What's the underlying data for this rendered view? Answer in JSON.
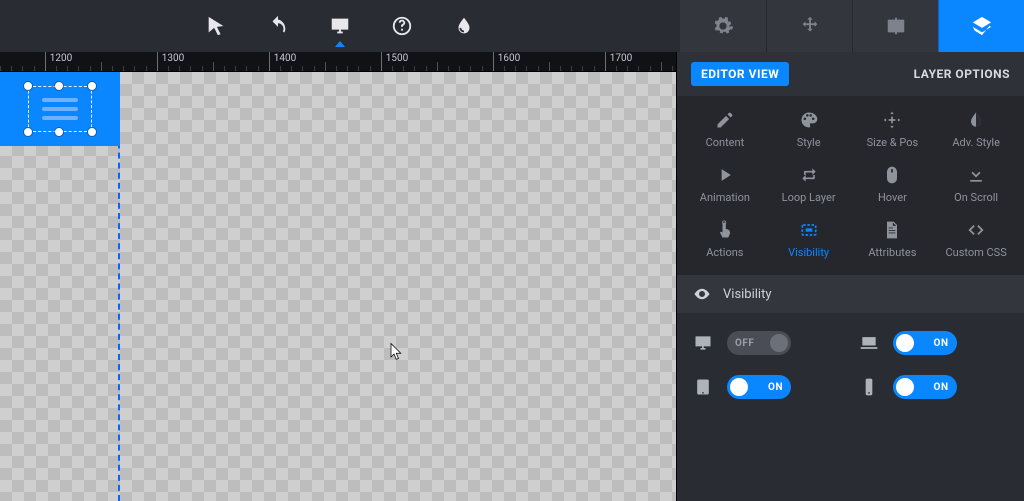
{
  "ruler": {
    "start": 1160,
    "major_step": 100,
    "pixels_per_unit": 1.12,
    "labels": [
      1200,
      1300,
      1400,
      1500,
      1600,
      1700
    ]
  },
  "sidebar": {
    "editor_view_label": "EDITOR VIEW",
    "title": "LAYER OPTIONS",
    "options": [
      {
        "key": "content",
        "label": "Content"
      },
      {
        "key": "style",
        "label": "Style"
      },
      {
        "key": "sizepos",
        "label": "Size & Pos"
      },
      {
        "key": "advstyle",
        "label": "Adv. Style"
      },
      {
        "key": "animation",
        "label": "Animation"
      },
      {
        "key": "looplayer",
        "label": "Loop Layer"
      },
      {
        "key": "hover",
        "label": "Hover"
      },
      {
        "key": "onscroll",
        "label": "On Scroll"
      },
      {
        "key": "actions",
        "label": "Actions"
      },
      {
        "key": "visibility",
        "label": "Visibility"
      },
      {
        "key": "attributes",
        "label": "Attributes"
      },
      {
        "key": "customcss",
        "label": "Custom CSS"
      }
    ],
    "active_option": "visibility"
  },
  "visibility": {
    "section_title": "Visibility",
    "toggles": {
      "desktop": {
        "state": "OFF"
      },
      "laptop": {
        "state": "ON"
      },
      "tablet": {
        "state": "ON"
      },
      "phone": {
        "state": "ON"
      }
    }
  },
  "canvas": {
    "guide_x_unit": 1265,
    "selected_layer": {
      "type": "hamburger-icon"
    }
  }
}
